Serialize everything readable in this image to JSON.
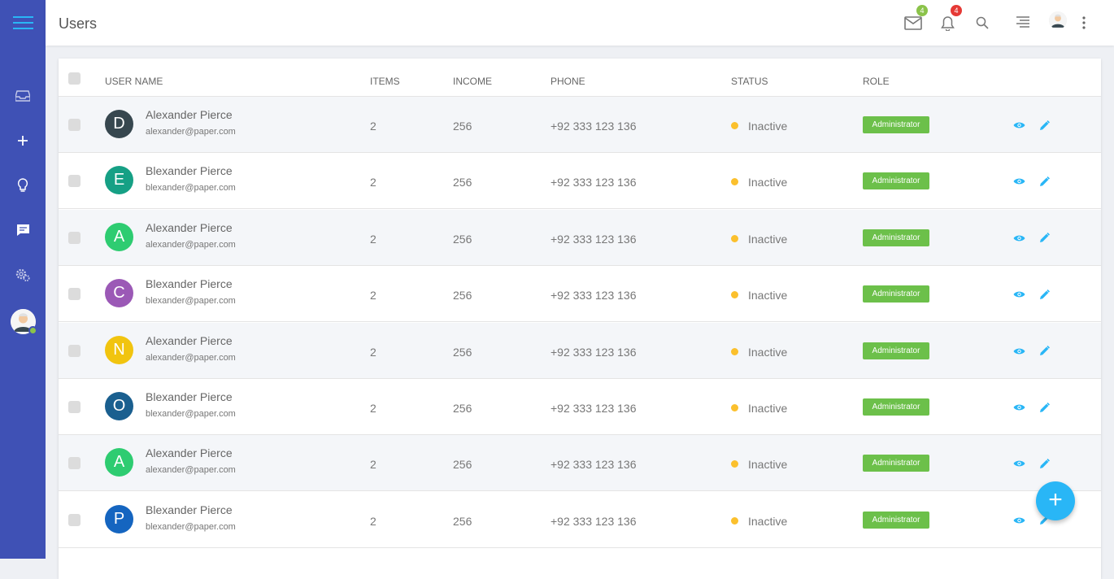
{
  "header": {
    "title": "Users",
    "mail_count": "4",
    "notification_count": "4"
  },
  "colors": {
    "sidebar": "#3f51b5",
    "accent": "#29b6f6",
    "role_badge": "#6cc04a",
    "status_inactive": "#fbc02d",
    "mail_badge": "#8bc34a",
    "notif_badge": "#e53935"
  },
  "sidebar": {
    "icons": [
      "menu-icon",
      "inbox-icon",
      "plus-icon",
      "lightbulb-icon",
      "chat-icon",
      "settings-icon",
      "avatar"
    ]
  },
  "table": {
    "headers": {
      "user_name": "USER NAME",
      "items": "ITEMS",
      "income": "INCOME",
      "phone": "PHONE",
      "status": "STATUS",
      "role": "ROLE"
    },
    "rows": [
      {
        "initial": "D",
        "color": "#37474f",
        "name": "Alexander Pierce",
        "email": "alexander@paper.com",
        "items": "2",
        "income": "256",
        "phone": "+92 333 123 136",
        "status": "Inactive",
        "role": "Administrator"
      },
      {
        "initial": "E",
        "color": "#16a085",
        "name": "Blexander Pierce",
        "email": "blexander@paper.com",
        "items": "2",
        "income": "256",
        "phone": "+92 333 123 136",
        "status": "Inactive",
        "role": "Administrator"
      },
      {
        "initial": "A",
        "color": "#2ecc71",
        "name": "Alexander Pierce",
        "email": "alexander@paper.com",
        "items": "2",
        "income": "256",
        "phone": "+92 333 123 136",
        "status": "Inactive",
        "role": "Administrator"
      },
      {
        "initial": "C",
        "color": "#9b59b6",
        "name": "Blexander Pierce",
        "email": "blexander@paper.com",
        "items": "2",
        "income": "256",
        "phone": "+92 333 123 136",
        "status": "Inactive",
        "role": "Administrator"
      },
      {
        "initial": "N",
        "color": "#f1c40f",
        "name": "Alexander Pierce",
        "email": "alexander@paper.com",
        "items": "2",
        "income": "256",
        "phone": "+92 333 123 136",
        "status": "Inactive",
        "role": "Administrator"
      },
      {
        "initial": "O",
        "color": "#1a5f8f",
        "name": "Blexander Pierce",
        "email": "blexander@paper.com",
        "items": "2",
        "income": "256",
        "phone": "+92 333 123 136",
        "status": "Inactive",
        "role": "Administrator"
      },
      {
        "initial": "A",
        "color": "#2ecc71",
        "name": "Alexander Pierce",
        "email": "alexander@paper.com",
        "items": "2",
        "income": "256",
        "phone": "+92 333 123 136",
        "status": "Inactive",
        "role": "Administrator"
      },
      {
        "initial": "P",
        "color": "#1565c0",
        "name": "Blexander Pierce",
        "email": "blexander@paper.com",
        "items": "2",
        "income": "256",
        "phone": "+92 333 123 136",
        "status": "Inactive",
        "role": "Administrator"
      }
    ]
  },
  "fab": {
    "label": "+"
  }
}
